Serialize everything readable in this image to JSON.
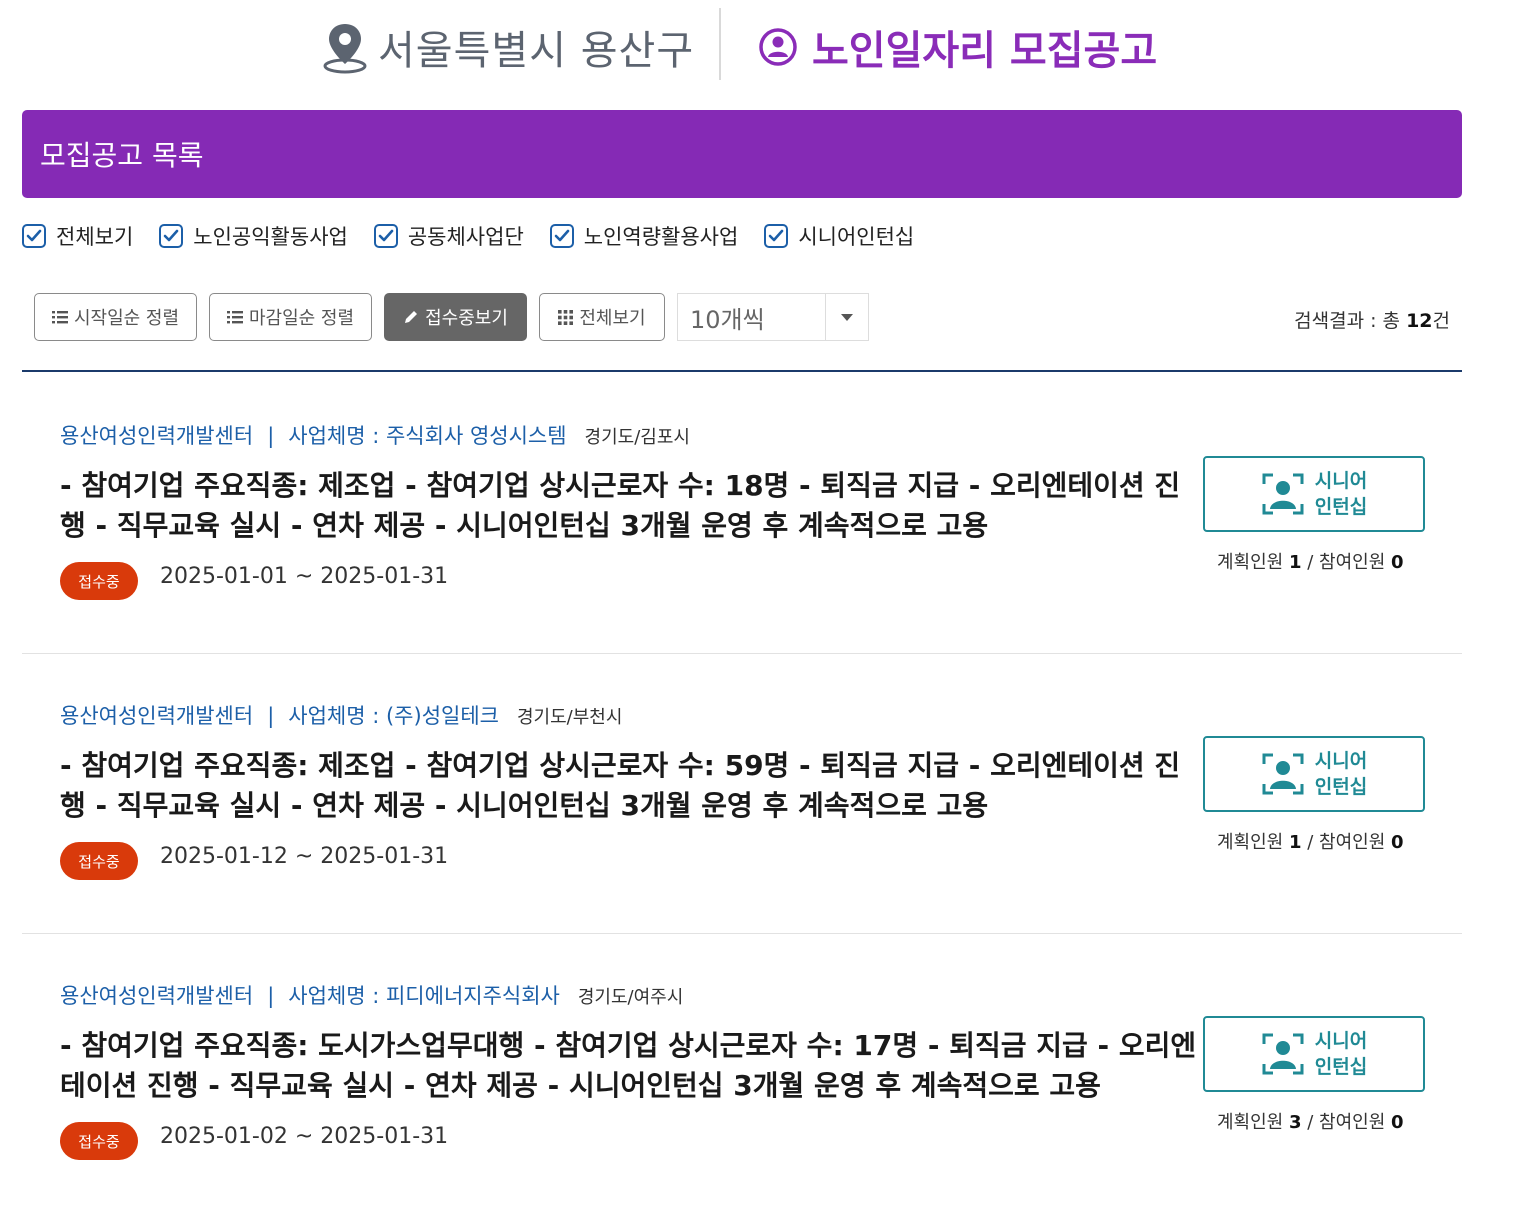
{
  "header": {
    "region": "서울특별시 용산구",
    "title": "노인일자리 모집공고"
  },
  "list": {
    "heading": "모집공고 목록"
  },
  "filters": [
    {
      "label": "전체보기",
      "checked": true
    },
    {
      "label": "노인공익활동사업",
      "checked": true
    },
    {
      "label": "공동체사업단",
      "checked": true
    },
    {
      "label": "노인역량활용사업",
      "checked": true
    },
    {
      "label": "시니어인턴십",
      "checked": true
    }
  ],
  "toolbar": {
    "sort_start": "시작일순 정렬",
    "sort_end": "마감일순 정렬",
    "receiving": "접수중보기",
    "view_all": "전체보기",
    "page_size": "10개씩",
    "results_prefix": "검색결과 : 총 ",
    "results_count": "12",
    "results_suffix": "건"
  },
  "colors": {
    "accent_purple": "#852ab5",
    "title_purple": "#8a2cb8",
    "link_blue": "#1c5fa8",
    "status_red": "#d93a0b",
    "badge_teal": "#208a95"
  },
  "jobs": [
    {
      "org": "용산여성인력개발센터",
      "separator": "|",
      "business": "사업체명 : 주식회사 영성시스템",
      "location": "경기도/김포시",
      "description": "- 참여기업 주요직종: 제조업 - 참여기업 상시근로자 수: 18명 - 퇴직금 지급 - 오리엔테이션 진행 - 직무교육 실시 - 연차 제공 - 시니어인턴십 3개월 운영 후 계속적으로 고용",
      "status": "접수중",
      "period": "2025-01-01 ~ 2025-01-31",
      "badge_line1": "시니어",
      "badge_line2": "인턴십",
      "planned_label": "계획인원 ",
      "planned": "1",
      "divider": " / ",
      "joined_label": "참여인원 ",
      "joined": "0"
    },
    {
      "org": "용산여성인력개발센터",
      "separator": "|",
      "business": "사업체명 : (주)성일테크",
      "location": "경기도/부천시",
      "description": "- 참여기업 주요직종: 제조업 - 참여기업 상시근로자 수: 59명 - 퇴직금 지급 - 오리엔테이션 진행 - 직무교육 실시 - 연차 제공 - 시니어인턴십 3개월 운영 후 계속적으로 고용",
      "status": "접수중",
      "period": "2025-01-12 ~ 2025-01-31",
      "badge_line1": "시니어",
      "badge_line2": "인턴십",
      "planned_label": "계획인원 ",
      "planned": "1",
      "divider": " / ",
      "joined_label": "참여인원 ",
      "joined": "0"
    },
    {
      "org": "용산여성인력개발센터",
      "separator": "|",
      "business": "사업체명 : 피디에너지주식회사",
      "location": "경기도/여주시",
      "description": "- 참여기업 주요직종: 도시가스업무대행 - 참여기업 상시근로자 수: 17명 - 퇴직금 지급 - 오리엔테이션 진행 - 직무교육 실시 - 연차 제공 - 시니어인턴십 3개월 운영 후 계속적으로 고용",
      "status": "접수중",
      "period": "2025-01-02 ~ 2025-01-31",
      "badge_line1": "시니어",
      "badge_line2": "인턴십",
      "planned_label": "계획인원 ",
      "planned": "3",
      "divider": " / ",
      "joined_label": "참여인원 ",
      "joined": "0"
    }
  ]
}
